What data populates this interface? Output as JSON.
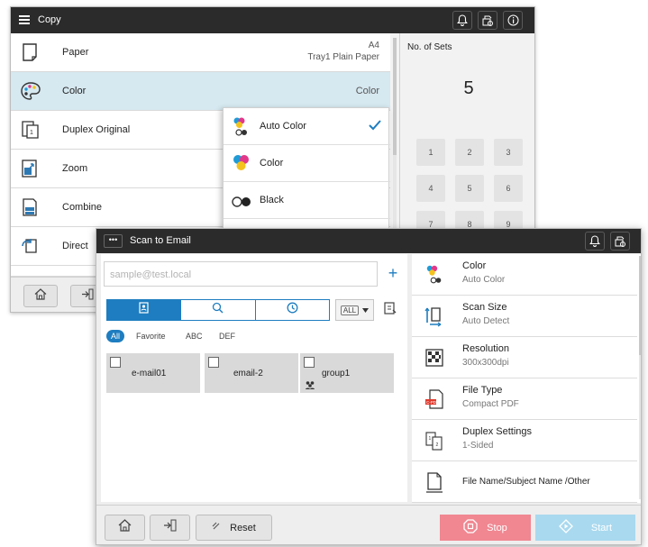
{
  "copy_window": {
    "title": "Copy",
    "settings": [
      {
        "label": "Paper",
        "value_line1": "A4",
        "value_line2": "Tray1  Plain Paper",
        "icon": "paper-icon"
      },
      {
        "label": "Color",
        "value": "Color",
        "icon": "color-palette-icon",
        "selected": true
      },
      {
        "label": "Duplex Original",
        "icon": "duplex-original-icon"
      },
      {
        "label": "Zoom",
        "icon": "zoom-icon"
      },
      {
        "label": "Combine",
        "icon": "combine-icon"
      },
      {
        "label": "Direct",
        "icon": "direct-icon"
      }
    ],
    "color_dropdown": [
      {
        "label": "Auto Color",
        "checked": true
      },
      {
        "label": "Color"
      },
      {
        "label": "Black"
      }
    ],
    "sets_label": "No. of Sets",
    "sets_value": "5",
    "keys": [
      "1",
      "2",
      "3",
      "4",
      "5",
      "6",
      "7",
      "8",
      "9"
    ],
    "accent": "#1e7dc0"
  },
  "scan_window": {
    "title": "Scan to Email",
    "address_placeholder": "sample@test.local",
    "add_symbol": "+",
    "all_dropdown": "ALL",
    "filters": [
      "All",
      "Favorite",
      "ABC",
      "DEF"
    ],
    "destinations": [
      {
        "name": "e-mail01"
      },
      {
        "name": "email-2"
      },
      {
        "name": "group1",
        "group": true
      }
    ],
    "functions": [
      {
        "title": "Color",
        "sub": "Auto Color",
        "icon": "color-icon"
      },
      {
        "title": "Scan Size",
        "sub": "Auto Detect",
        "icon": "scan-size-icon"
      },
      {
        "title": "Resolution",
        "sub": "300x300dpi",
        "icon": "resolution-icon"
      },
      {
        "title": "File Type",
        "sub": "Compact PDF",
        "icon": "pdf-file-icon"
      },
      {
        "title": "Duplex Settings",
        "sub": "1-Sided",
        "icon": "duplex-settings-icon"
      },
      {
        "title": "File Name/Subject Name /Other",
        "icon": "file-name-icon"
      }
    ],
    "reset_label": "Reset",
    "stop_label": "Stop",
    "start_label": "Start",
    "stop_color": "#f08791",
    "start_color": "#a9d9ef"
  }
}
